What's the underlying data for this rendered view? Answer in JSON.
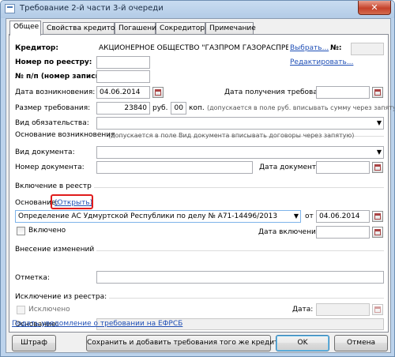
{
  "window": {
    "title": "Требование 2-й части 3-й очереди",
    "close_glyph": "✕"
  },
  "tabs": [
    "Общее",
    "Свойства кредитора",
    "Погашение",
    "Сокредиторы",
    "Примечание"
  ],
  "creditor": {
    "label": "Кредитор:",
    "value": "АКЦИОНЕРНОЕ ОБЩЕСТВО \"ГАЗПРОМ ГАЗОРАСПРЕДЕЛЕНИЕ И",
    "select_link": "Выбрать...",
    "edit_link": "Редактировать...",
    "number_label": "№:"
  },
  "registry_number": {
    "label": "Номер по реестру:",
    "value": ""
  },
  "record_number": {
    "label": "№ п/п (номер записи):",
    "value": ""
  },
  "occurrence_date": {
    "label": "Дата возникновения:",
    "value": "04.06.2014"
  },
  "receipt_date": {
    "label": "Дата получения требования:",
    "value": ""
  },
  "amount": {
    "label": "Размер требования:",
    "rub_value": "23840",
    "rub_unit": "руб.",
    "kop_value": "00",
    "kop_unit": "коп.",
    "hint": "(допускается в поле руб. вписывать сумму через запятую)"
  },
  "obligation_type": {
    "label": "Вид обязательства:",
    "value": ""
  },
  "basis_group": {
    "title": "Основание возникновения",
    "hint": "(допускается в поле Вид документа вписывать договоры через запятую)"
  },
  "document_type": {
    "label": "Вид документа:",
    "value": ""
  },
  "document_number": {
    "label": "Номер документа:",
    "value": ""
  },
  "document_date": {
    "label": "Дата документа:",
    "value": ""
  },
  "inclusion_group": {
    "title": "Включение в реестр"
  },
  "inclusion_basis": {
    "label": "Основание:",
    "open_link": "(Открыть)",
    "value": "Определение АС Удмуртской Республики по делу № А71-14496/2013",
    "from_label": "от",
    "date": "04.06.2014"
  },
  "included_checkbox": {
    "label": "Включено",
    "checked": false
  },
  "inclusion_date": {
    "label": "Дата включения:",
    "value": ""
  },
  "changes_group": {
    "title": "Внесение изменений"
  },
  "mark": {
    "label": "Отметка:",
    "value": ""
  },
  "exclusion_group": {
    "title": "Исключение из реестра:"
  },
  "excluded_checkbox": {
    "label": "Исключено",
    "checked": false
  },
  "exclusion_date": {
    "label": "Дата:",
    "value": ""
  },
  "exclusion_basis": {
    "label": "Основание:",
    "value": ""
  },
  "efrsb_link": "Подать уведомление о требовании на ЕФРСБ",
  "buttons": {
    "fine": "Штраф",
    "save_add": "Сохранить и добавить требования того же кредитора",
    "ok": "OK",
    "cancel": "Отмена"
  },
  "icons": {
    "dropdown": "▼"
  }
}
